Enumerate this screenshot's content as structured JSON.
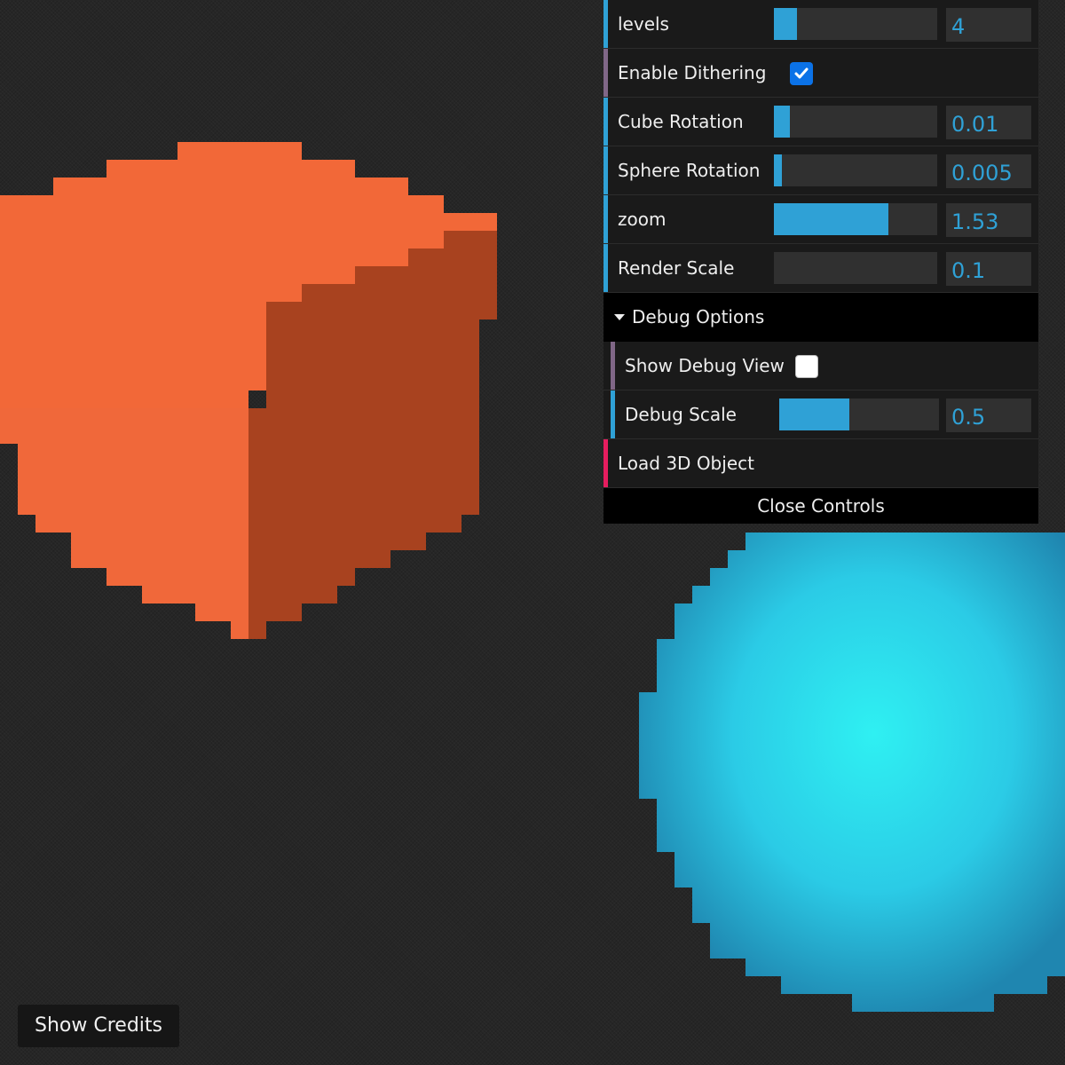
{
  "scene": {
    "cube_colors": {
      "top": "#f26838",
      "left": "#f0683a",
      "right": "#a8421f"
    },
    "sphere_colors": {
      "center": "#2fe6ee",
      "mid": "#2bcbe6",
      "edge": "#1f8db4"
    }
  },
  "controls": {
    "accent": "#2fa1d6",
    "levels": {
      "label": "levels",
      "value": "4",
      "fill": 0.14
    },
    "dithering": {
      "label": "Enable Dithering",
      "checked": true
    },
    "cube_rotation": {
      "label": "Cube Rotation",
      "value": "0.01",
      "fill": 0.1
    },
    "sphere_rotation": {
      "label": "Sphere Rotation",
      "value": "0.005",
      "fill": 0.05
    },
    "zoom": {
      "label": "zoom",
      "value": "1.53",
      "fill": 0.7
    },
    "render_scale": {
      "label": "Render Scale",
      "value": "0.1",
      "fill": 0.0
    },
    "debug_folder": {
      "label": "Debug Options",
      "show_debug": {
        "label": "Show Debug View",
        "checked": false
      },
      "debug_scale": {
        "label": "Debug Scale",
        "value": "0.5",
        "fill": 0.44
      }
    },
    "load_object": {
      "label": "Load 3D Object"
    },
    "close_label": "Close Controls"
  },
  "credits_label": "Show Credits"
}
